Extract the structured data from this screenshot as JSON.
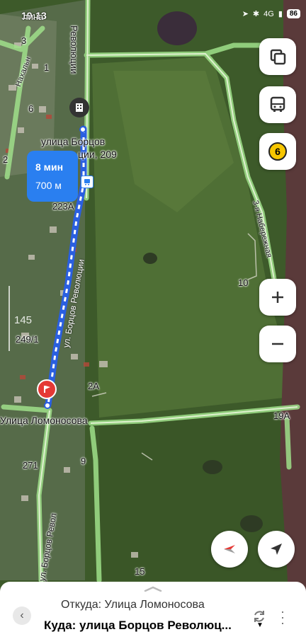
{
  "status_bar": {
    "time": "19:13",
    "network": "4G",
    "battery": "86"
  },
  "route_card": {
    "time": "8 мин",
    "distance": "700 м"
  },
  "map_labels": {
    "top_left_street": "лина",
    "street_revolutsii_top": "Революции",
    "destination_name_1": "улица Борцов",
    "destination_name_2": "ции, 209",
    "house_223a": "223А",
    "street_bortsov_mid": "ул. Борцов Революции",
    "house_249": "249/1",
    "house_2a": "2А",
    "street_lomonosova": "Улица Ломоносова",
    "house_271": "271",
    "house_9": "9",
    "street_bortsov_bottom": "ул. Борцов Револ",
    "house_15": "15",
    "house_19a": "19А",
    "house_10": "10",
    "embankment": "3-я Набережная",
    "house_3": "3",
    "house_1": "1",
    "house_6": "6",
    "house_2": "2",
    "street_left": "Нахальн",
    "scale_number": "145"
  },
  "controls": {
    "traffic_badge": "6"
  },
  "route_sheet": {
    "from_label": "Откуда: Улица Ломоносова",
    "to_label": "Куда: улица Борцов Революц...",
    "dropdown": "▼"
  },
  "colors": {
    "accent": "#2a7ff0",
    "route_start": "#e53935",
    "traffic": "#f7c600"
  }
}
